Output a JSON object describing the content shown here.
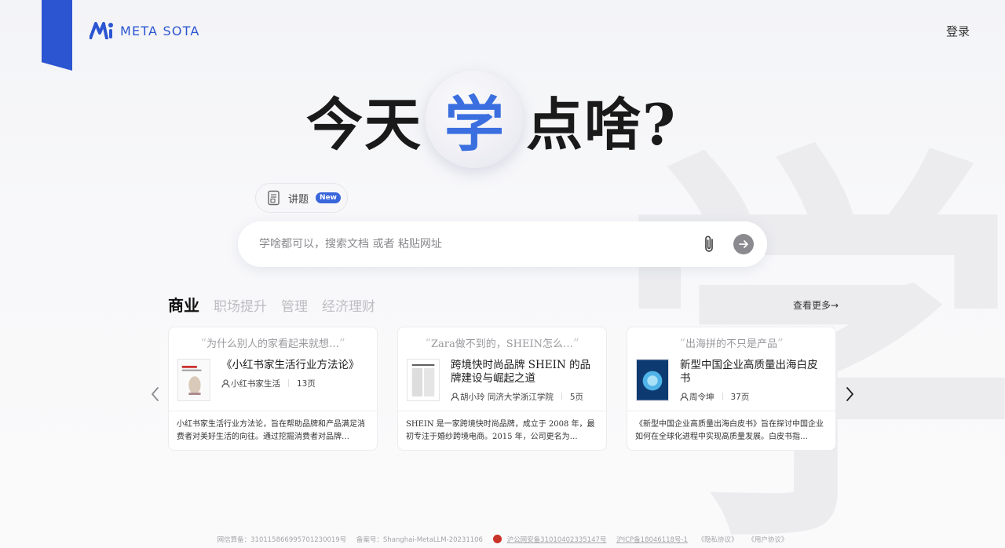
{
  "brand": {
    "name": "META SOTA",
    "color": "#2c55d1"
  },
  "header": {
    "login_label": "登录"
  },
  "hero": {
    "pre": "今天",
    "highlight": "学",
    "post": "点啥?"
  },
  "background_glyph": "学",
  "feature_chip": {
    "label": "讲题",
    "badge": "New",
    "icon": "document-icon"
  },
  "search": {
    "placeholder": "学啥都可以，搜索文档 或者 粘贴网址",
    "value": "",
    "attach_icon": "paperclip-icon",
    "submit_icon": "arrow-right-icon"
  },
  "category_tabs": [
    {
      "label": "商业",
      "active": true
    },
    {
      "label": "职场提升",
      "active": false
    },
    {
      "label": "管理",
      "active": false
    },
    {
      "label": "经济理财",
      "active": false
    }
  ],
  "view_more_label": "查看更多→",
  "cards": [
    {
      "quote": "为什么别人的家看起来就想…",
      "title": "《小红书家生活行业方法论》",
      "author": "小红书家生活",
      "pages": "13页",
      "desc": "小红书家生活行业方法论，旨在帮助品牌和产品满足消费者对美好生活的向往。通过挖掘消费者对品牌…"
    },
    {
      "quote": "Zara做不到的，SHEIN怎么…",
      "title": "跨境快时尚品牌 SHEIN 的品牌建设与崛起之道",
      "author": "胡小玲 同济大学浙江学院",
      "pages": "5页",
      "desc": "SHEIN 是一家跨境快时尚品牌，成立于 2008 年，最初专注于婚纱跨境电商。2015 年，公司更名为…"
    },
    {
      "quote": "出海拼的不只是产品",
      "title": "新型中国企业高质量出海白皮书",
      "author": "周令坤",
      "pages": "37页",
      "desc": "《新型中国企业高质量出海白皮书》旨在探讨中国企业如何在全球化进程中实现高质量发展。白皮书指…"
    }
  ],
  "footer": {
    "items": [
      "网信算备：310115866995701230019号",
      "备案号：Shanghai-MetaLLM-20231106",
      "沪公网安备31010402335147号",
      "沪ICP备18046118号-1",
      "《隐私协议》",
      "《用户协议》"
    ]
  }
}
